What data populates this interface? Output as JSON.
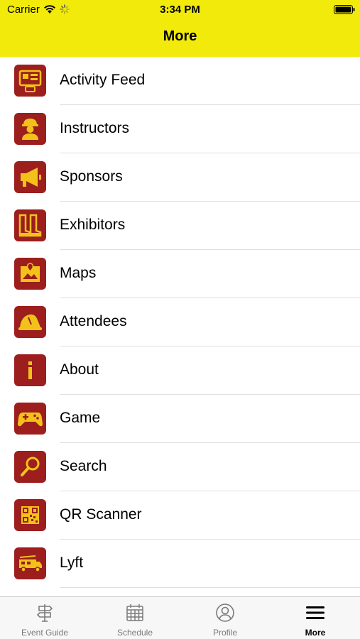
{
  "status_bar": {
    "carrier": "Carrier",
    "time": "3:34 PM"
  },
  "nav": {
    "title": "More"
  },
  "colors": {
    "header": "#f2ea0a",
    "icon_bg": "#9c1e1d",
    "icon_fg": "#f2c21b"
  },
  "menu": {
    "items": [
      {
        "label": "Activity Feed",
        "icon": "activity-feed-icon"
      },
      {
        "label": "Instructors",
        "icon": "instructor-icon"
      },
      {
        "label": "Sponsors",
        "icon": "megaphone-icon"
      },
      {
        "label": "Exhibitors",
        "icon": "boots-icon"
      },
      {
        "label": "Maps",
        "icon": "map-icon"
      },
      {
        "label": "Attendees",
        "icon": "helmet-icon"
      },
      {
        "label": "About",
        "icon": "info-icon"
      },
      {
        "label": "Game",
        "icon": "gamepad-icon"
      },
      {
        "label": "Search",
        "icon": "magnifier-icon"
      },
      {
        "label": "QR Scanner",
        "icon": "qr-code-icon"
      },
      {
        "label": "Lyft",
        "icon": "fire-truck-icon"
      }
    ]
  },
  "tabs": [
    {
      "label": "Event Guide",
      "icon": "signpost-icon",
      "active": false
    },
    {
      "label": "Schedule",
      "icon": "calendar-icon",
      "active": false
    },
    {
      "label": "Profile",
      "icon": "profile-icon",
      "active": false
    },
    {
      "label": "More",
      "icon": "hamburger-icon",
      "active": true
    }
  ]
}
